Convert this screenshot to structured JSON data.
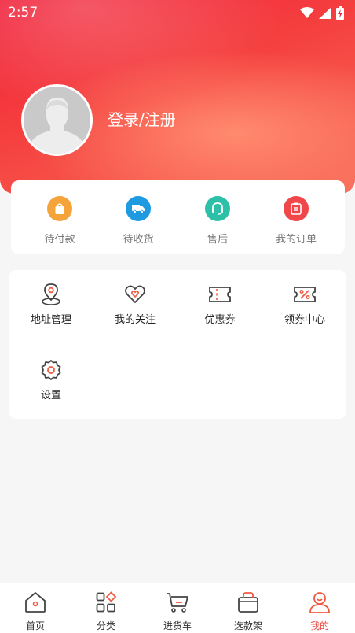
{
  "status": {
    "time": "2:57"
  },
  "profile": {
    "login_text": "登录/注册"
  },
  "orders": [
    {
      "label": "待付款",
      "icon": "shopping-bag-icon",
      "color": "#f5a33b"
    },
    {
      "label": "待收货",
      "icon": "delivery-truck-icon",
      "color": "#1d9ae0"
    },
    {
      "label": "售后",
      "icon": "headset-icon",
      "color": "#2dc0a8"
    },
    {
      "label": "我的订单",
      "icon": "order-list-icon",
      "color": "#f0474a"
    }
  ],
  "tools": [
    {
      "label": "地址管理",
      "icon": "location-pin-icon"
    },
    {
      "label": "我的关注",
      "icon": "heart-icon"
    },
    {
      "label": "优惠券",
      "icon": "coupon-icon"
    },
    {
      "label": "领券中心",
      "icon": "percent-ticket-icon"
    },
    {
      "label": "设置",
      "icon": "gear-icon"
    }
  ],
  "tabbar": [
    {
      "label": "首页",
      "icon": "home-icon",
      "active": false
    },
    {
      "label": "分类",
      "icon": "category-grid-icon",
      "active": false
    },
    {
      "label": "进货车",
      "icon": "cart-icon",
      "active": false
    },
    {
      "label": "选款架",
      "icon": "basket-icon",
      "active": false
    },
    {
      "label": "我的",
      "icon": "user-icon",
      "active": true
    }
  ],
  "colors": {
    "accent": "#e9453d",
    "brand_red": "#f0203a"
  }
}
